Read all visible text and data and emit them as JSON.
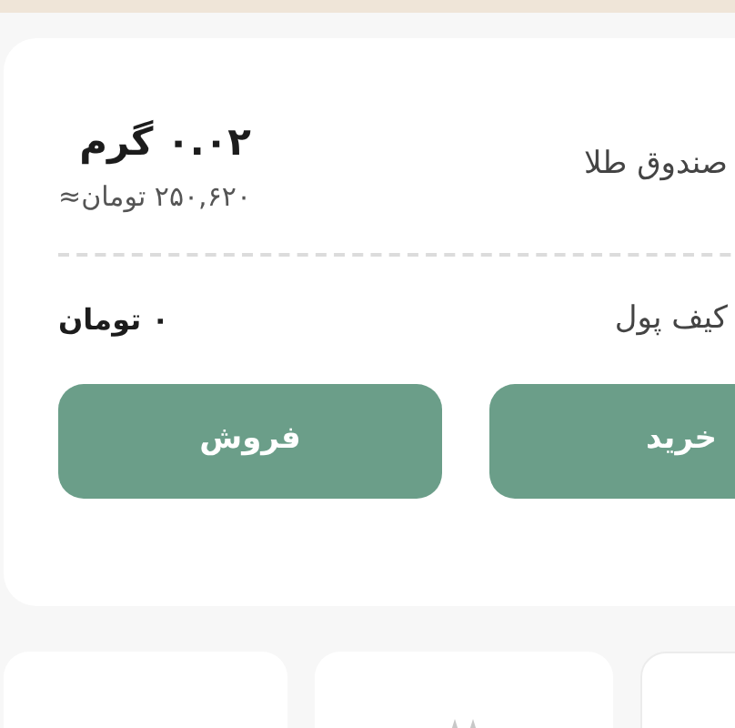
{
  "gold_box": {
    "label": "صندوق طلا",
    "amount": "۰.۰۲ گرم",
    "value": "۲۵۰,۶۲۰ تومان≈"
  },
  "wallet": {
    "label": "کیف پول",
    "balance": "۰ تومان"
  },
  "buttons": [
    {
      "label": "خرید"
    },
    {
      "label": "فروش"
    }
  ]
}
